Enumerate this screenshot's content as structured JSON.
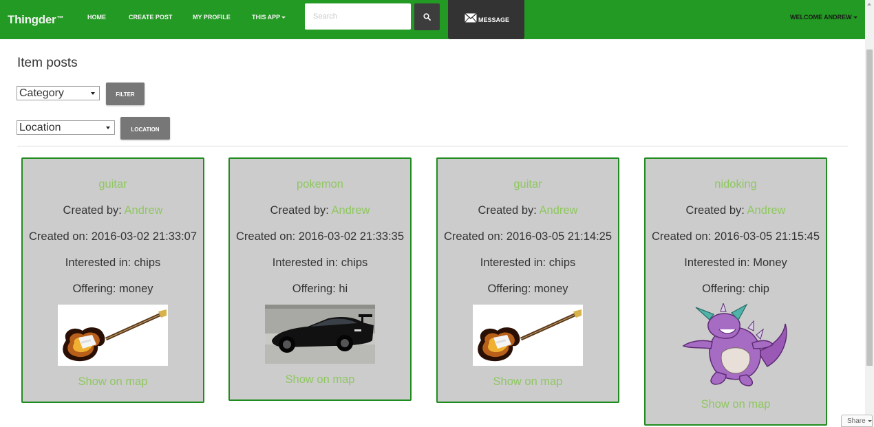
{
  "nav": {
    "brand": "Thingder",
    "brand_mark": "™",
    "links": [
      "HOME",
      "CREATE POST",
      "MY PROFILE",
      "THIS APP"
    ],
    "search_placeholder": "Search",
    "search_icon": "search-icon",
    "message_label": "MESSAGE",
    "message_icon": "envelope-icon",
    "welcome": "WELCOME ANDREW",
    "colors": {
      "bar": "#239a23",
      "dark_button": "#333333"
    }
  },
  "page": {
    "title": "Item posts",
    "filters": {
      "category_value": "Category",
      "filter_button": "FILTER",
      "location_value": "Location",
      "location_button": "LOCATION"
    }
  },
  "posts": [
    {
      "title": "guitar",
      "created_by_label": "Created by: ",
      "created_by": "Andrew",
      "created_on": "Created on: 2016-03-02 21:33:07",
      "interested": "Interested in: chips",
      "offering": "Offering: money",
      "image": "guitar-photo",
      "map_link": "Show on map"
    },
    {
      "title": "pokemon",
      "created_by_label": "Created by: ",
      "created_by": "Andrew",
      "created_on": "Created on: 2016-03-02 21:33:35",
      "interested": "Interested in: chips",
      "offering": "Offering: hi",
      "image": "black-car-photo",
      "map_link": "Show on map"
    },
    {
      "title": "guitar",
      "created_by_label": "Created by: ",
      "created_by": "Andrew",
      "created_on": "Created on: 2016-03-05 21:14:25",
      "interested": "Interested in: chips",
      "offering": "Offering: money",
      "image": "guitar-photo",
      "map_link": "Show on map"
    },
    {
      "title": "nidoking",
      "created_by_label": "Created by: ",
      "created_by": "Andrew",
      "created_on": "Created on: 2016-03-05 21:15:45",
      "interested": "Interested in: Money",
      "offering": "Offering: chip",
      "image": "nidoking-image",
      "map_link": "Show on map"
    }
  ],
  "card_colors": {
    "background": "#cccccc",
    "border": "#1f8c1f",
    "link": "#8fc760"
  },
  "share_label": "Share"
}
